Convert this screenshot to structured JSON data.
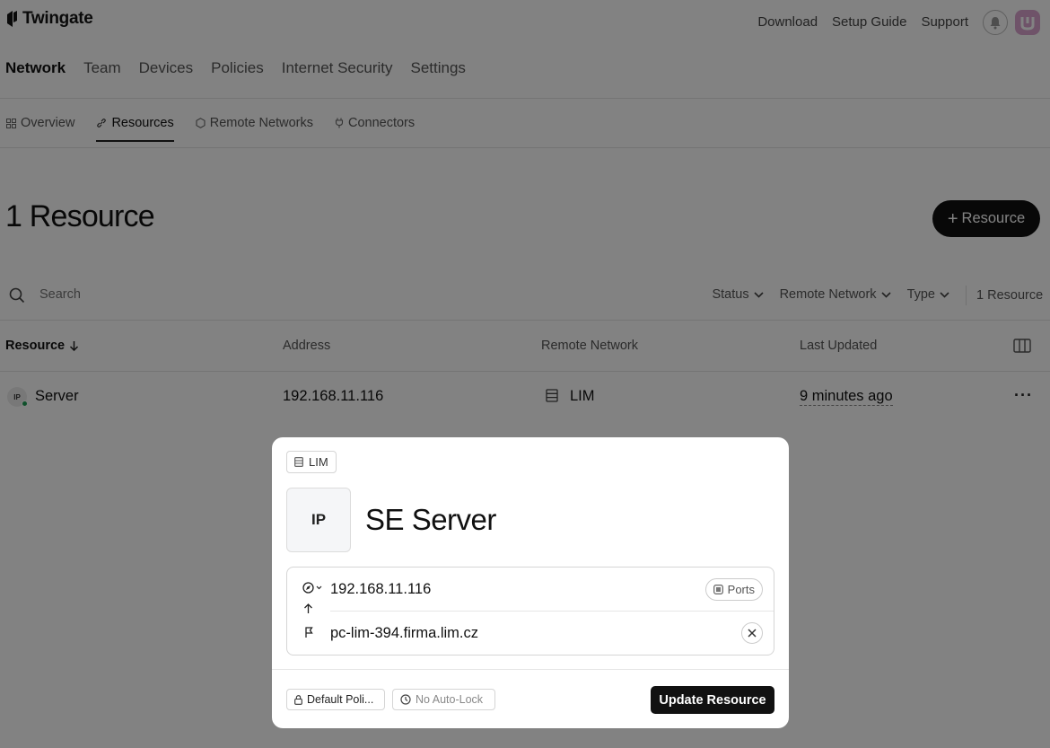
{
  "brand": {
    "name": "Twingate"
  },
  "topbar": {
    "links": [
      "Download",
      "Setup Guide",
      "Support"
    ]
  },
  "main_nav": [
    "Network",
    "Team",
    "Devices",
    "Policies",
    "Internet Security",
    "Settings"
  ],
  "sub_nav": [
    "Overview",
    "Resources",
    "Remote Networks",
    "Connectors"
  ],
  "page": {
    "title": "1 Resource",
    "add_button": "Resource"
  },
  "search": {
    "placeholder": "Search"
  },
  "filters": [
    "Status",
    "Remote Network",
    "Type"
  ],
  "filter_count": "1 Resource",
  "table": {
    "columns": [
      "Resource",
      "Address",
      "Remote Network",
      "Last Updated"
    ],
    "rows": [
      {
        "type_badge": "IP",
        "name": "Server",
        "address": "192.168.11.116",
        "network": "LIM",
        "updated": "9 minutes ago"
      }
    ]
  },
  "modal": {
    "network_chip": "LIM",
    "type_badge": "IP",
    "title": "SE Server",
    "address": "192.168.11.116",
    "ports_label": "Ports",
    "alias": "pc-lim-394.firma.lim.cz",
    "policy_label": "Default Poli...",
    "autolock_label": "No Auto-Lock",
    "update_button": "Update Resource"
  },
  "colors": {
    "accent": "#111111",
    "status_online": "#1f9d55",
    "avatar": "#d9a3cf",
    "overlay": "rgba(0,0,0,0.49)"
  },
  "icons": [
    "bell-icon",
    "search-icon",
    "chevron-down-icon",
    "columns-icon",
    "server-icon",
    "link-icon",
    "grid-icon",
    "hexagon-icon",
    "plug-icon",
    "lock-icon",
    "clock-icon",
    "close-icon"
  ]
}
